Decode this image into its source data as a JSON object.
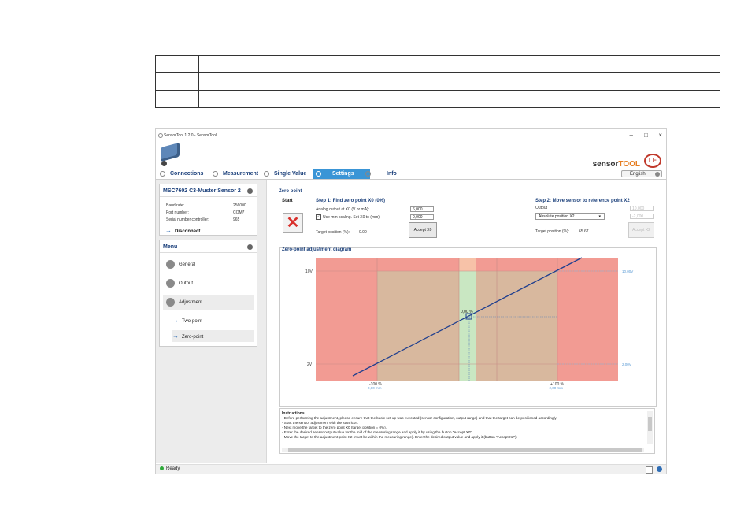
{
  "window": {
    "title": "SensorTool 1.2.0 - SensorTool",
    "min": "–",
    "max": "□",
    "close": "×"
  },
  "brand": {
    "sensor": "sensor",
    "tool": "TOOL",
    "logo": "LE"
  },
  "tabs": [
    {
      "label": "Connections"
    },
    {
      "label": "Measurement"
    },
    {
      "label": "Single Value"
    },
    {
      "label": "Settings"
    },
    {
      "label": "Info"
    }
  ],
  "language": "English",
  "sensor_panel": {
    "title": "MSC7602 C3-Muster Sensor 2",
    "rows": [
      {
        "key": "Baud rate:",
        "value": "256000"
      },
      {
        "key": "Port number:",
        "value": "COM7"
      },
      {
        "key": "Serial number controller:",
        "value": "965"
      }
    ],
    "disconnect": "Disconnect"
  },
  "menu": {
    "title": "Menu",
    "items": [
      {
        "label": "General"
      },
      {
        "label": "Output"
      },
      {
        "label": "Adjustment"
      }
    ],
    "sub_items": [
      {
        "label": "Two-point"
      },
      {
        "label": "Zero-point"
      }
    ]
  },
  "zero_point": {
    "title": "Zero point",
    "start_label": "Start",
    "step1": {
      "title": "Step 1: Find zero point X0 (0%)",
      "analog_label": "Analog output at X0 (V or mA):",
      "analog_value": "6,000",
      "scaling_label": "Use mm scaling. Set X0 to (mm):",
      "scaling_checked": "☑",
      "scaling_value": "0,000",
      "target_label": "Target position (%):",
      "target_value": "0.00",
      "accept": "Accept X0"
    },
    "step2": {
      "title": "Step 2: Move sensor to reference point X2",
      "output_label": "Output",
      "output_value": "10,000",
      "select_value": "Absolute position X2",
      "mm_value": "-2,000",
      "target_label": "Target position (%):",
      "target_value": "65.67",
      "accept": "Accept X2"
    }
  },
  "diagram": {
    "title": "Zero-point adjustment diagram",
    "y_top": "10V",
    "y_bottom": "2V",
    "right_top": "10.00V",
    "right_bottom": "2.00V",
    "point_label": "0,00 %",
    "x_left_pct": "-100 %",
    "x_left_mm": "2,00 mm",
    "x_right_pct": "+100 %",
    "x_right_mm": "-2,00 mm"
  },
  "instructions": {
    "title": "Instructions",
    "lines": [
      "- Before performing the adjustment, please ensure that the basic set-up was executed (sensor configuration, output range) and that the target can be positioned accordingly.",
      "- Start the sensor adjustment with the start icon.",
      "- Next move the target to the zero point X0 (target position = 0%).",
      "- Enter the desired sensor output value for the mid of the measuring range and apply it by using the button \"Accept X0\".",
      "- Move the target to the adjustment point X2 (must be within the measuring range). Enter the desired output value and apply it (button \"Accept X2\")."
    ]
  },
  "status": "Ready",
  "colors": {
    "accent": "#3a95d6",
    "title_blue": "#1a3f7a",
    "red_zone": "#f39a93",
    "tan_zone": "#d9b9a0",
    "green_zone": "#c9e9c3",
    "line": "#1f3f8f"
  }
}
